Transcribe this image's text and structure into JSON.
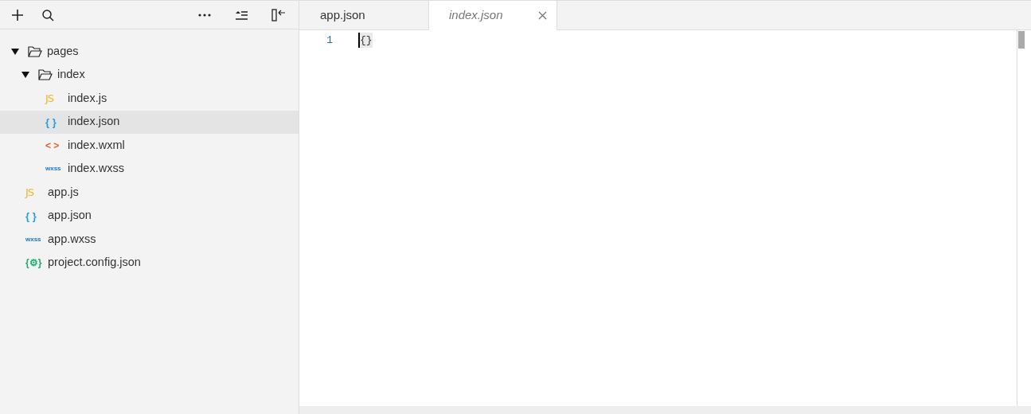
{
  "toolbar": {
    "buttons": [
      {
        "kind": "add"
      },
      {
        "kind": "search"
      },
      {
        "kind": "more"
      },
      {
        "kind": "collapse"
      },
      {
        "kind": "hide"
      }
    ]
  },
  "tree": [
    {
      "label": "pages",
      "kind": "folder",
      "expanded": true,
      "selected": false,
      "children": [
        {
          "label": "index",
          "kind": "folder",
          "expanded": true,
          "selected": false,
          "children": [
            {
              "label": "index.js",
              "kind": "js",
              "icon": "JS",
              "selected": false
            },
            {
              "label": "index.json",
              "kind": "json",
              "icon": "{ }",
              "selected": true
            },
            {
              "label": "index.wxml",
              "kind": "wxml",
              "icon": "< >",
              "selected": false
            },
            {
              "label": "index.wxss",
              "kind": "wxss",
              "icon": "wxss",
              "selected": false
            }
          ]
        }
      ]
    },
    {
      "label": "app.js",
      "kind": "js",
      "icon": "JS",
      "selected": false
    },
    {
      "label": "app.json",
      "kind": "json",
      "icon": "{ }",
      "selected": false
    },
    {
      "label": "app.wxss",
      "kind": "wxss",
      "icon": "wxss",
      "selected": false
    },
    {
      "label": "project.config.json",
      "kind": "config",
      "icon": "{⚙}",
      "selected": false
    }
  ],
  "tabs": [
    {
      "label": "app.json",
      "selected": false
    },
    {
      "label": "index.json",
      "selected": true
    }
  ],
  "editor": {
    "lines": [
      {
        "number": "1",
        "text": "{}"
      }
    ]
  }
}
